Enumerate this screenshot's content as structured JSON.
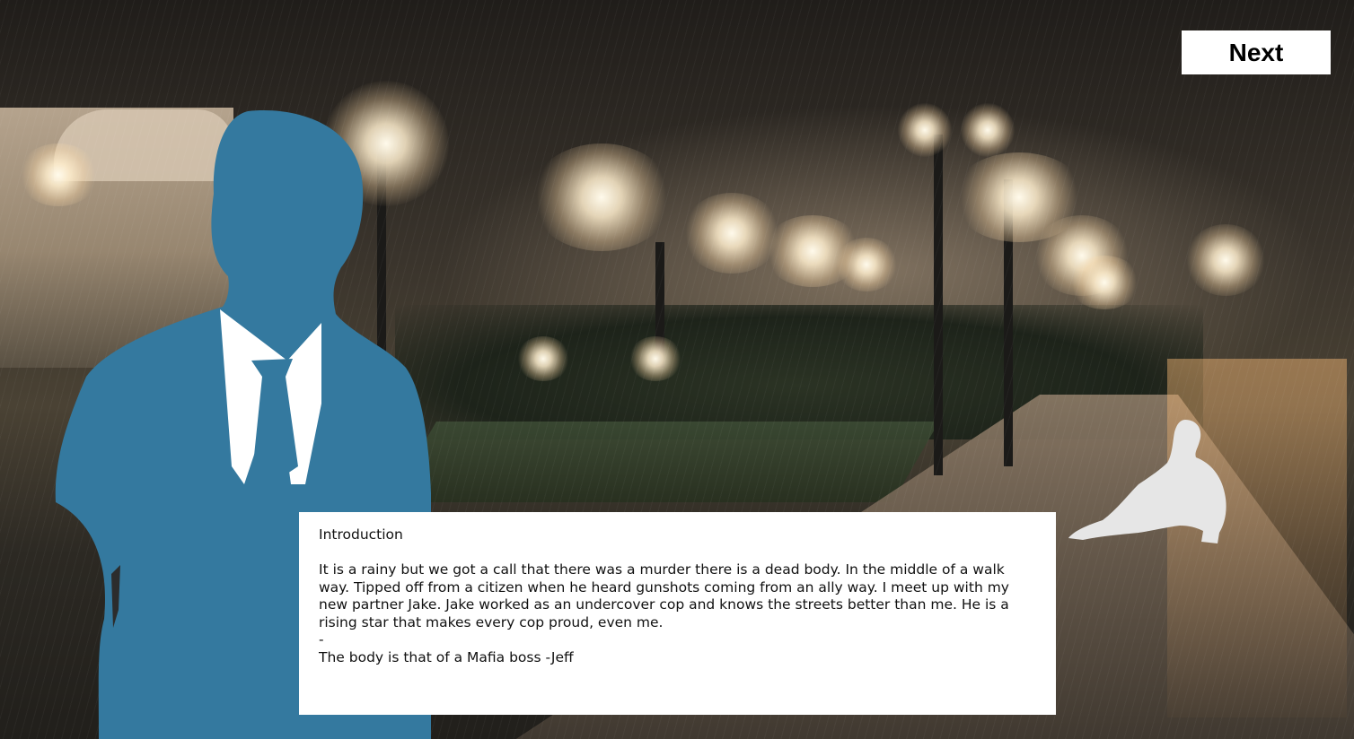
{
  "game": {
    "next_label": "Next",
    "dialog": {
      "title": "Introduction",
      "body": "It is a rainy but we got a call that there was a murder there is a dead body. In the middle of a walk way. Tipped off from a citizen when he heard gunshots coming from an ally way. I meet up with my new partner Jake. Jake worked as an undercover cop and knows the streets better than me. He is a rising star that makes every cop proud, even me.",
      "separator": "-",
      "closing": "The body is that of a Mafia boss -Jeff"
    }
  },
  "colors": {
    "detective_silhouette": "#34799f",
    "shirt": "#ffffff",
    "bystander_silhouette": "#e6e6e6",
    "dialog_background": "#ffffff",
    "button_background": "#ffffff"
  },
  "scene": {
    "background": "rainy night promenade with street lamps",
    "characters": [
      "detective-silhouette",
      "seated-person-silhouette"
    ]
  }
}
